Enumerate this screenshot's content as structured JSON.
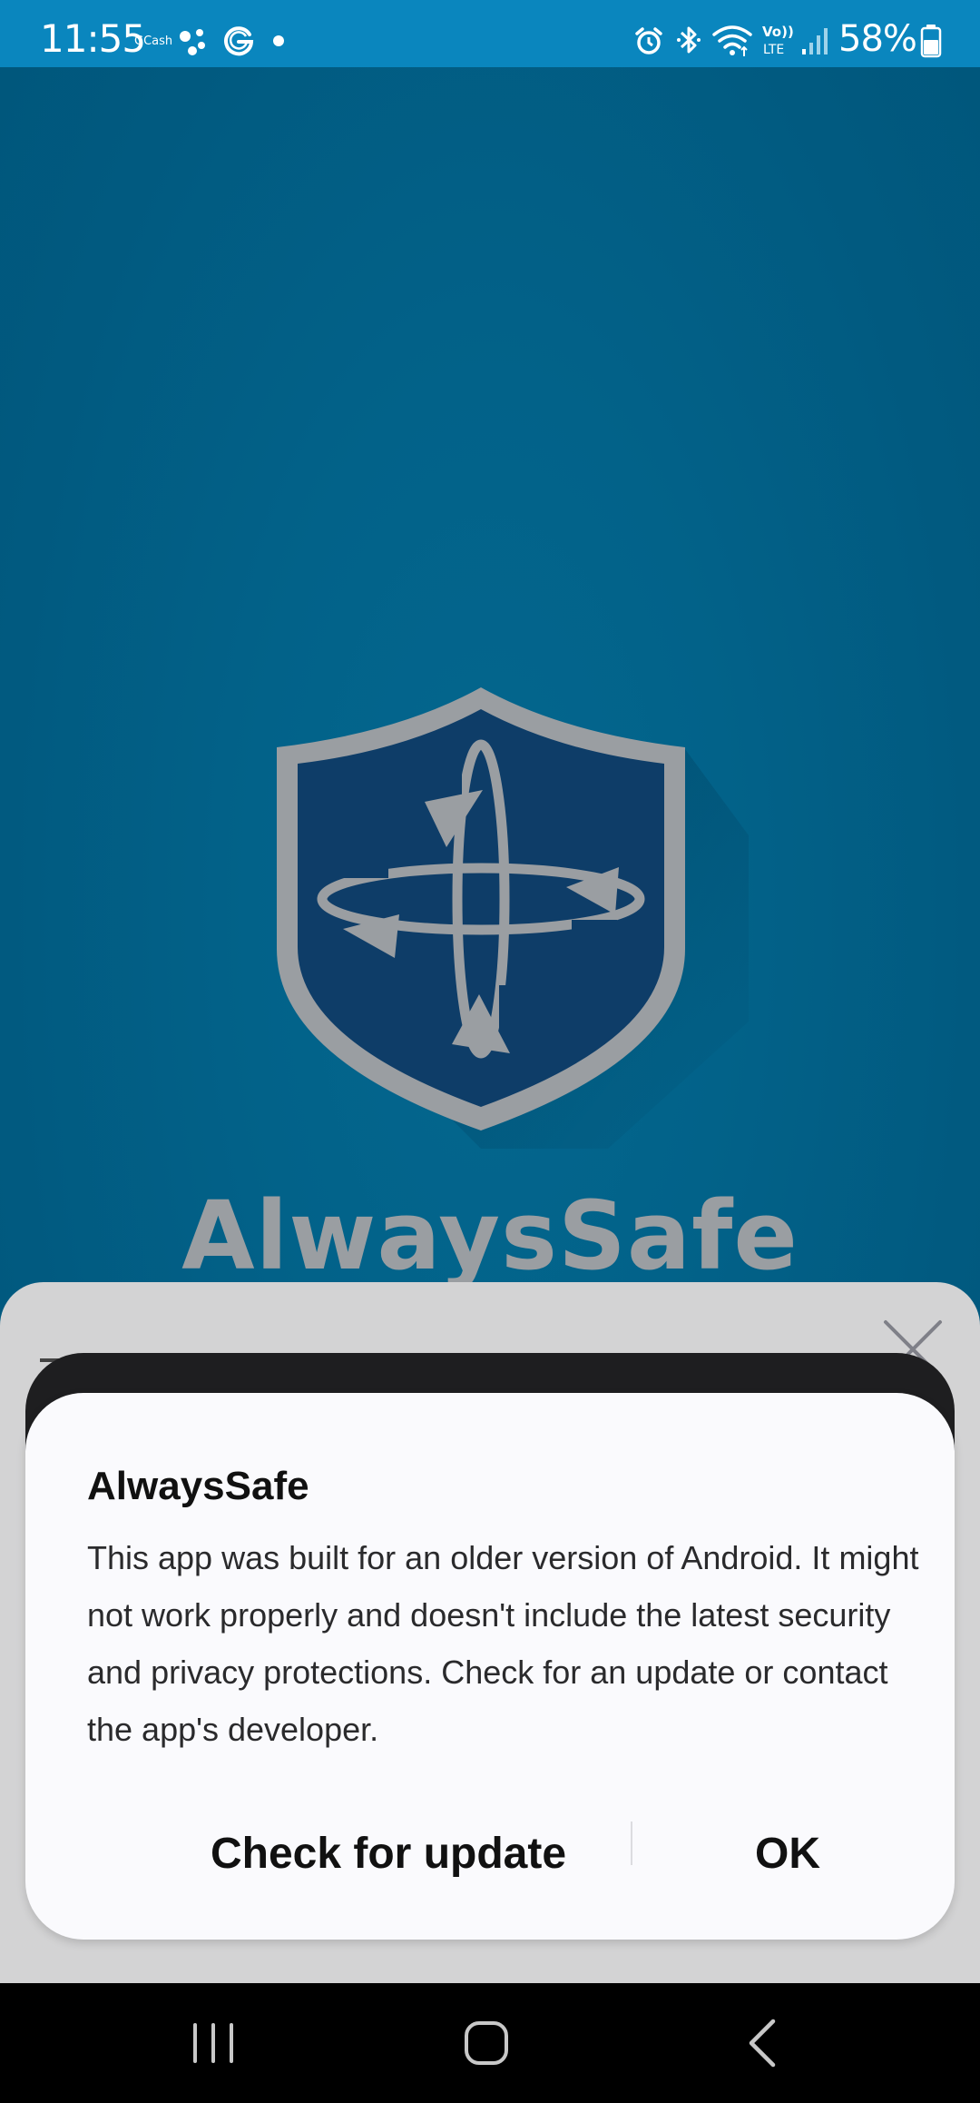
{
  "status_bar": {
    "time": "11:55",
    "gcash_label": "GCash",
    "battery_percent": "58%",
    "icons": [
      "assistant-dots-icon",
      "g-icon",
      "dot-icon",
      "alarm-icon",
      "bluetooth-icon",
      "wifi-icon",
      "volte-icon",
      "signal-icon",
      "battery-icon"
    ],
    "background_color": "#0a86be"
  },
  "splash": {
    "app_name": "AlwaysSafe",
    "logo_icon": "shield-arrows-icon",
    "background_color": "#015d84"
  },
  "dialog": {
    "title": "AlwaysSafe",
    "message": "This app was built for an older version of Android. It might not work properly and doesn't include the latest security and privacy protections. Check for an update or contact the app's developer.",
    "buttons": {
      "check_update": "Check for update",
      "ok": "OK"
    }
  },
  "nav_bar": {
    "icons": [
      "recent-apps-icon",
      "home-icon",
      "back-icon"
    ]
  }
}
